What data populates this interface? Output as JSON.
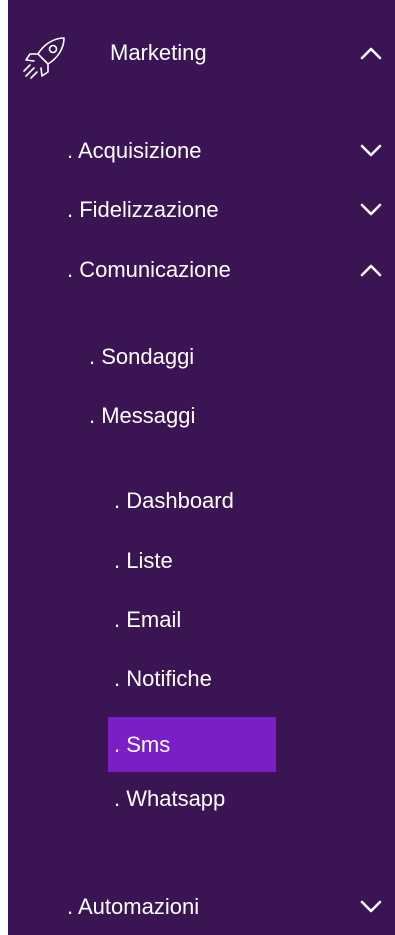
{
  "menu": {
    "header": {
      "label": "Marketing",
      "icon": "rocket-icon",
      "expanded": true
    },
    "items": [
      {
        "label": ". Acquisizione",
        "expanded": false
      },
      {
        "label": ". Fidelizzazione",
        "expanded": false
      },
      {
        "label": ". Comunicazione",
        "expanded": true
      },
      {
        "label": ". Automazioni",
        "expanded": false
      }
    ],
    "comunicazione_children": [
      {
        "label": ". Sondaggi"
      },
      {
        "label": ". Messaggi"
      }
    ],
    "messaggi_children": [
      {
        "label": ". Dashboard"
      },
      {
        "label": ". Liste"
      },
      {
        "label": ". Email"
      },
      {
        "label": ". Notifiche"
      },
      {
        "label": ". Sms",
        "selected": true
      },
      {
        "label": ". Whatsapp"
      }
    ]
  },
  "colors": {
    "background": "#3b1553",
    "selected": "#7a1fc8",
    "text": "#ffffff"
  }
}
